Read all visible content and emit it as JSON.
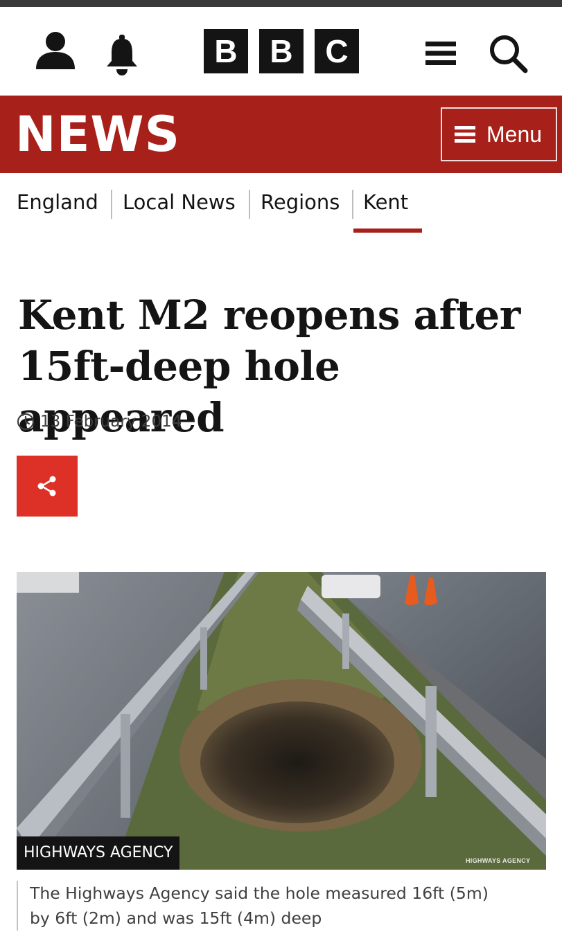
{
  "masthead": {
    "logo_letters": [
      "B",
      "B",
      "C"
    ],
    "icons": [
      "user-icon",
      "bell-icon",
      "hamburger-icon",
      "search-icon"
    ]
  },
  "news_bar": {
    "title": "NEWS",
    "menu_label": "Menu",
    "background_color": "#a8201a"
  },
  "subnav": {
    "items": [
      {
        "label": "England",
        "active": false
      },
      {
        "label": "Local News",
        "active": false
      },
      {
        "label": "Regions",
        "active": false
      },
      {
        "label": "Kent",
        "active": true
      }
    ]
  },
  "article": {
    "headline_line1": "Kent M2 reopens after",
    "headline_line2": "15ft-deep hole appeared",
    "date": "13 February 2014",
    "share_color": "#dd3127"
  },
  "image": {
    "credit": "HIGHWAYS AGENCY",
    "watermark": "HIGHWAYS AGENCY",
    "caption_line1": "The Highways Agency said the hole measured 16ft (5m)",
    "caption_line2": "by 6ft (2m) and was 15ft (4m) deep"
  }
}
